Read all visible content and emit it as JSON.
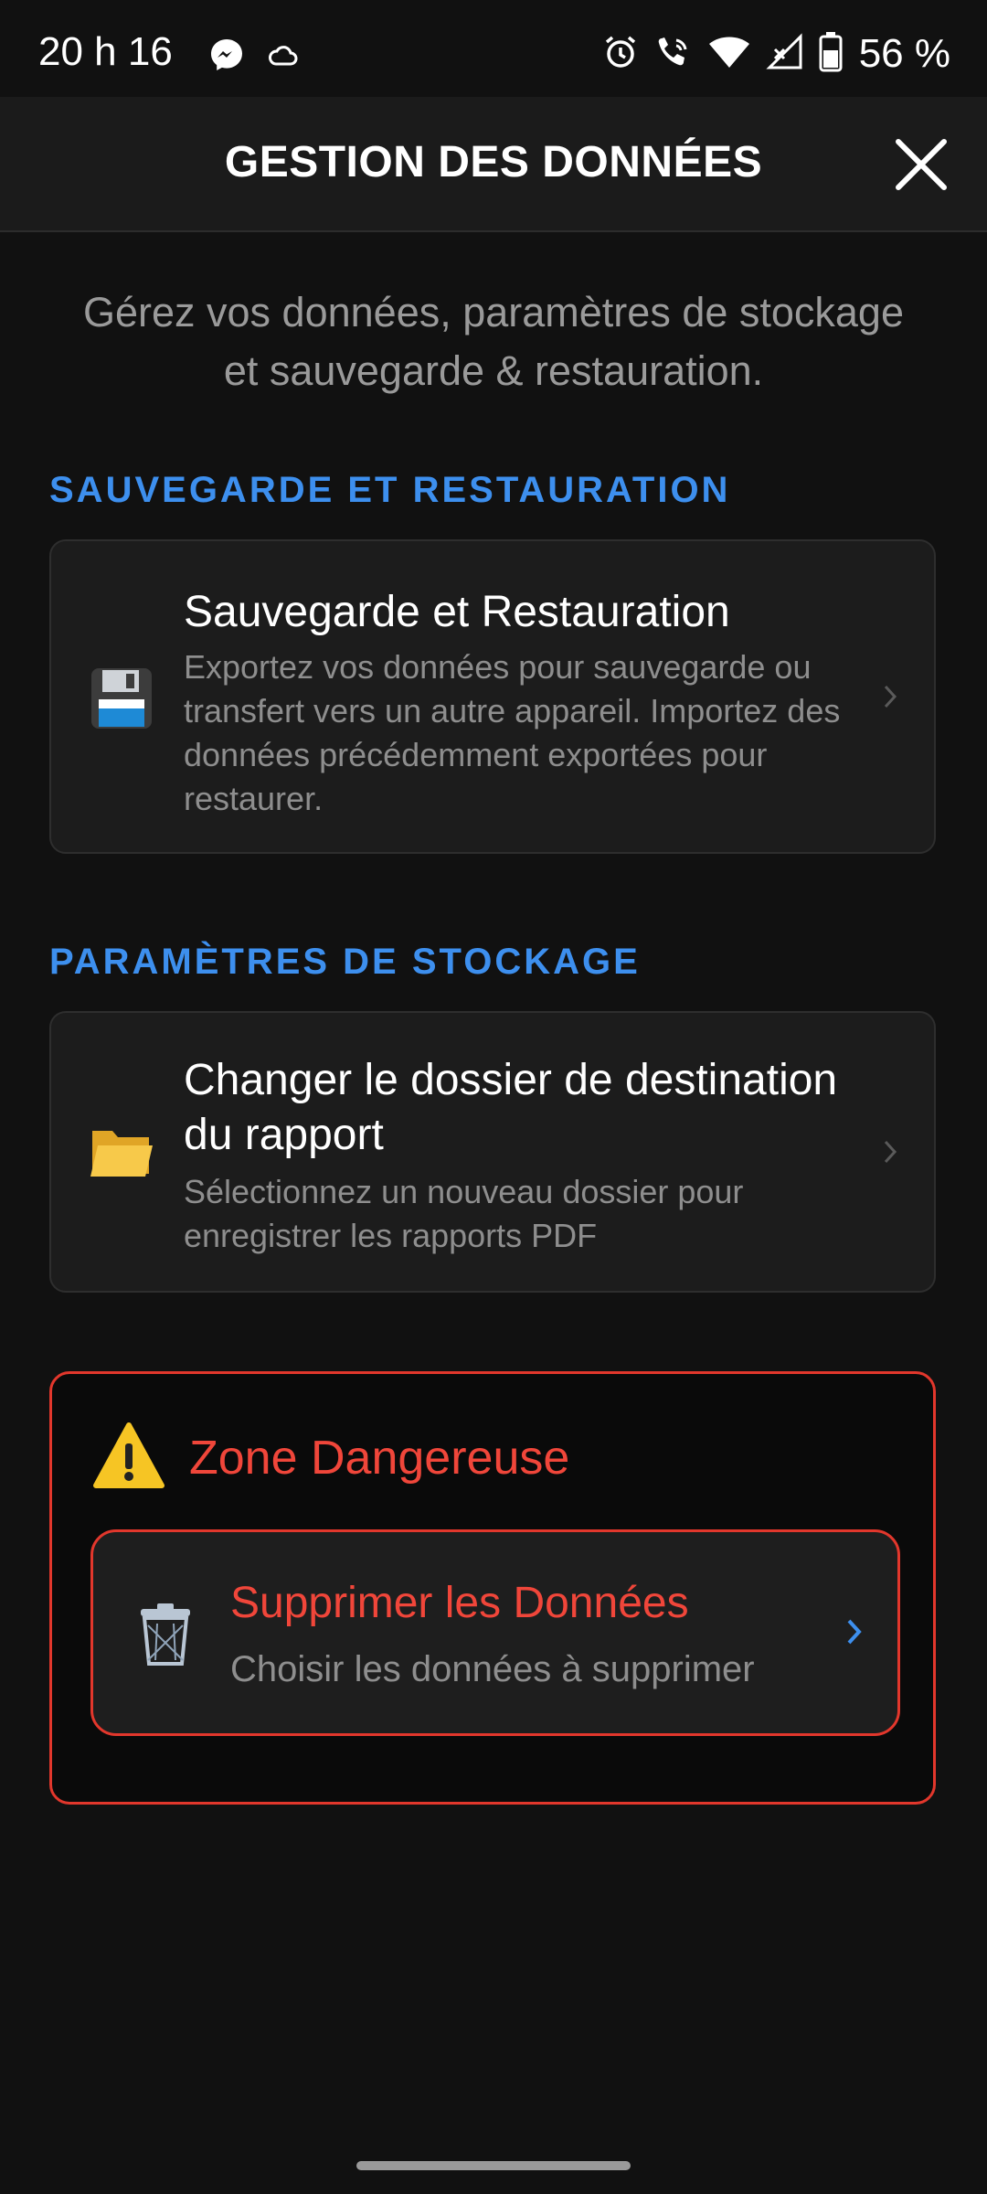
{
  "status_bar": {
    "time": "20 h 16",
    "battery": "56 %"
  },
  "header": {
    "title": "GESTION DES DONNÉES"
  },
  "intro": "Gérez vos données, paramètres de stockage et sauvegarde & restauration.",
  "sections": [
    {
      "title": "SAUVEGARDE ET RESTAURATION",
      "card": {
        "icon": "floppy-disk-icon",
        "title": "Sauvegarde et Restauration",
        "description": "Exportez vos données pour sauvegarde ou transfert vers un autre appareil. Importez des données précédemment exportées pour restaurer."
      }
    },
    {
      "title": "PARAMÈTRES DE STOCKAGE",
      "card": {
        "icon": "folder-icon",
        "title": "Changer le dossier de destination du rapport",
        "description": "Sélectionnez un nouveau dossier pour enregistrer les rapports PDF"
      }
    }
  ],
  "danger_zone": {
    "title": "Zone Dangereuse",
    "action": {
      "title": "Supprimer les Données",
      "description": "Choisir les données à supprimer"
    }
  },
  "colors": {
    "accent": "#3d8fee",
    "danger": "#e2372c",
    "background": "#111111",
    "card": "#1c1c1c"
  }
}
